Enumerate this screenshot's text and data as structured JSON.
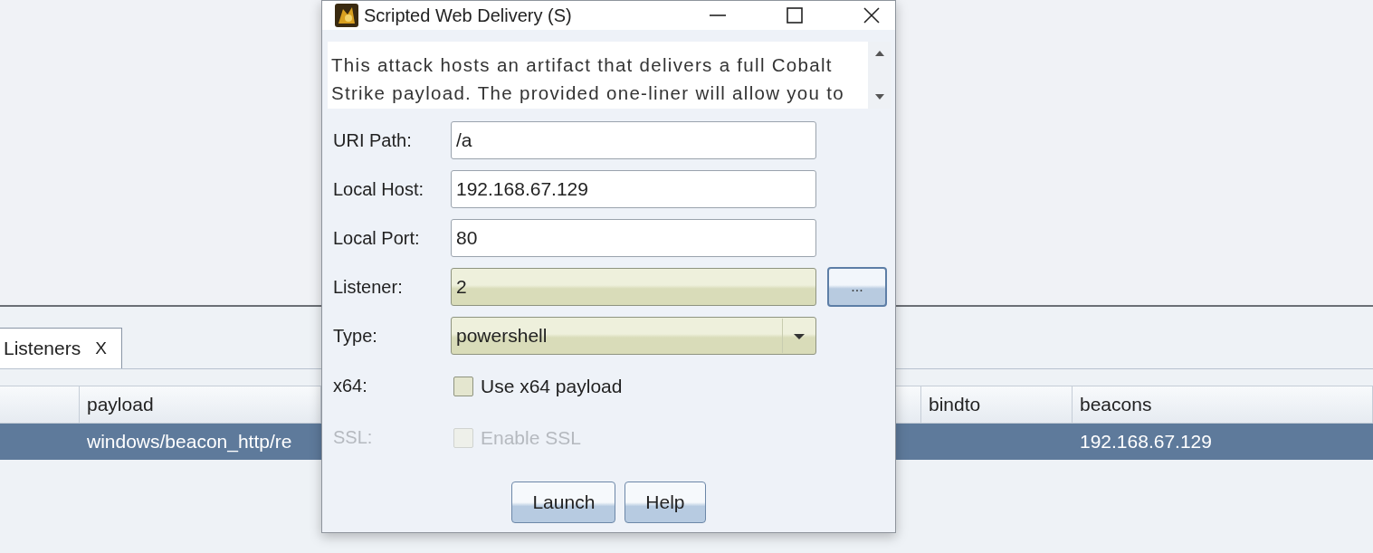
{
  "tabs": [
    {
      "label": "Listeners",
      "close": "X",
      "selected": true
    }
  ],
  "table": {
    "columns": [
      "payload",
      "bindto",
      "beacons"
    ],
    "rows": [
      {
        "selected": true,
        "payload": "windows/beacon_http/re",
        "beacons": "192.168.67.129"
      }
    ]
  },
  "dialog": {
    "title": "Scripted Web Delivery (S)",
    "description": "This attack hosts an artifact that delivers a full Cobalt Strike payload. The provided one-liner will allow you to",
    "fields": [
      {
        "kind": "text",
        "label": "URI Path:",
        "value": "/a",
        "disabled": false
      },
      {
        "kind": "text",
        "label": "Local Host:",
        "value": "192.168.67.129",
        "disabled": false
      },
      {
        "kind": "text",
        "label": "Local Port:",
        "value": "80",
        "disabled": false
      },
      {
        "kind": "picker",
        "label": "Listener:",
        "value": "2",
        "button": "...",
        "disabled": false
      },
      {
        "kind": "select",
        "label": "Type:",
        "value": "powershell",
        "disabled": false
      },
      {
        "kind": "checkbox",
        "label": "x64:",
        "text": "Use x64 payload",
        "checked": false,
        "disabled": false
      },
      {
        "kind": "checkbox",
        "label": "SSL:",
        "text": "Enable SSL",
        "checked": false,
        "disabled": true
      }
    ],
    "buttons": [
      "Launch",
      "Help"
    ]
  }
}
